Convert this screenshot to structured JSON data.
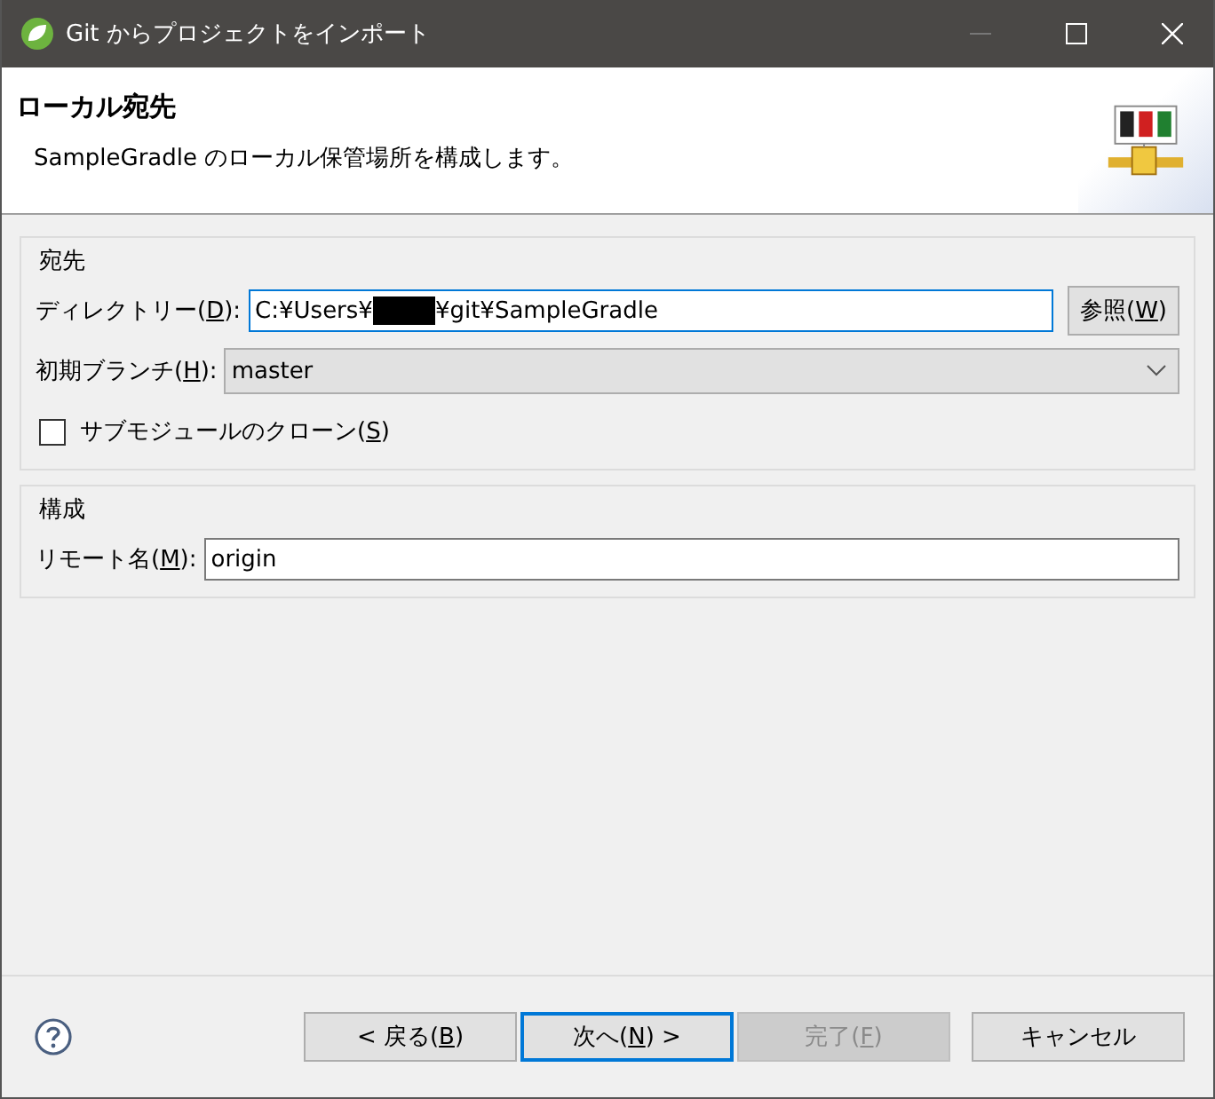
{
  "window": {
    "title": "Git からプロジェクトをインポート"
  },
  "header": {
    "title": "ローカル宛先",
    "description": "SampleGradle のローカル保管場所を構成します。"
  },
  "groups": [
    {
      "title": "宛先",
      "rows": [
        {
          "kind": "path",
          "label_pre": "ディレクトリー(",
          "accel": "D",
          "label_post": "):",
          "value_parts": [
            {
              "kind": "text",
              "text": "C:¥Users¥"
            },
            {
              "kind": "redaction"
            },
            {
              "kind": "text",
              "text": "¥git¥SampleGradle"
            }
          ],
          "focused": true,
          "button": {
            "label_pre": "参照(",
            "accel": "W",
            "label_post": ")"
          }
        },
        {
          "kind": "combo",
          "label_pre": "初期ブランチ(",
          "accel": "H",
          "label_post": "):",
          "value": "master"
        },
        {
          "kind": "checkbox",
          "label_pre": "サブモジュールのクローン(",
          "accel": "S",
          "label_post": ")",
          "checked": false
        }
      ]
    },
    {
      "title": "構成",
      "rows": [
        {
          "kind": "text",
          "label_pre": "リモート名(",
          "accel": "M",
          "label_post": "):",
          "value": "origin"
        }
      ]
    }
  ],
  "buttons": [
    {
      "label_pre": "< 戻る(",
      "accel": "B",
      "label_post": ")",
      "disabled": false,
      "default": false
    },
    {
      "label_pre": "次へ(",
      "accel": "N",
      "label_post": ") >",
      "disabled": false,
      "default": true
    },
    {
      "label_pre": "完了(",
      "accel": "F",
      "label_post": ")",
      "disabled": true,
      "default": false
    },
    {
      "label_pre": "キャンセル",
      "disabled": false,
      "default": false
    }
  ]
}
